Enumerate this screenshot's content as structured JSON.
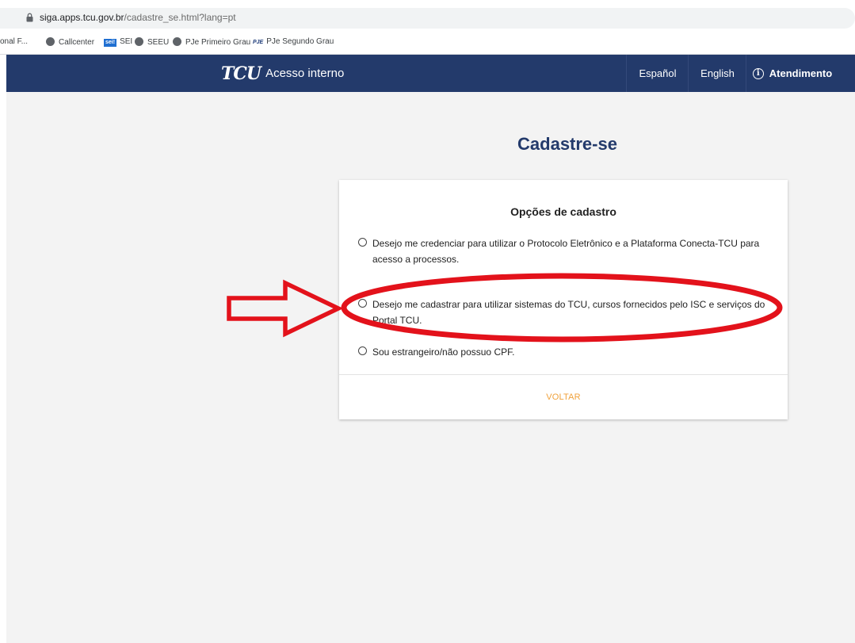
{
  "browser": {
    "url_host": "siga.apps.tcu.gov.br",
    "url_path": "/cadastre_se.html?lang=pt",
    "bookmarks": [
      {
        "label": "onal F...",
        "icon": "none"
      },
      {
        "label": "Callcenter",
        "icon": "globe-icon"
      },
      {
        "label": "SEI",
        "icon": "sei-icon",
        "badge": "sei!"
      },
      {
        "label": "SEEU",
        "icon": "globe-icon"
      },
      {
        "label": "PJe Primeiro Grau",
        "icon": "globe-icon"
      },
      {
        "label": "PJe Segundo Grau",
        "icon": "pje-icon",
        "badge": "PJE"
      }
    ]
  },
  "nav": {
    "logo_text": "TCU",
    "brand": "Acesso interno",
    "espanol": "Español",
    "english": "English",
    "atendimento": "Atendimento",
    "info_glyph": "i"
  },
  "page": {
    "title": "Cadastre-se"
  },
  "card": {
    "title": "Opções de cadastro",
    "options": [
      {
        "label": "Desejo me credenciar para utilizar o Protocolo Eletrônico e a Plataforma Conecta-TCU para acesso a processos."
      },
      {
        "label": "Desejo me cadastrar para utilizar sistemas do TCU, cursos fornecidos pelo ISC e serviços do Portal TCU."
      },
      {
        "label": "Sou estrangeiro/não possuo CPF."
      }
    ],
    "back_label": "VOLTAR"
  },
  "colors": {
    "nav_bg": "#233a6b",
    "title": "#233a6b",
    "back": "#f0a23c",
    "annotation": "#e3121b"
  }
}
